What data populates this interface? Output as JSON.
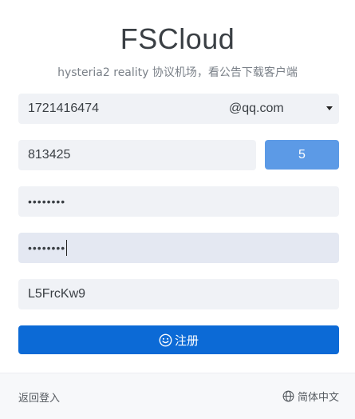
{
  "header": {
    "title": "FSCloud",
    "subtitle": "hysteria2 reality 协议机场，看公告下载客户端"
  },
  "form": {
    "email_user": "1721416474",
    "email_domain": "@qq.com",
    "invite_code": "813425",
    "code_button_label": "5",
    "password_mask": "••••••••",
    "password_confirm_mask": "••••••••",
    "captcha_value": "L5FrcKw9",
    "register_label": "注册"
  },
  "footer": {
    "back_login": "返回登入",
    "language": "简体中文"
  },
  "icons": {
    "register": "smile-icon",
    "language": "globe-icon",
    "dropdown": "caret-down-icon"
  },
  "colors": {
    "primary": "#0c6ad6",
    "code_button": "#5c9ae6",
    "input_bg": "#f0f2f6"
  }
}
